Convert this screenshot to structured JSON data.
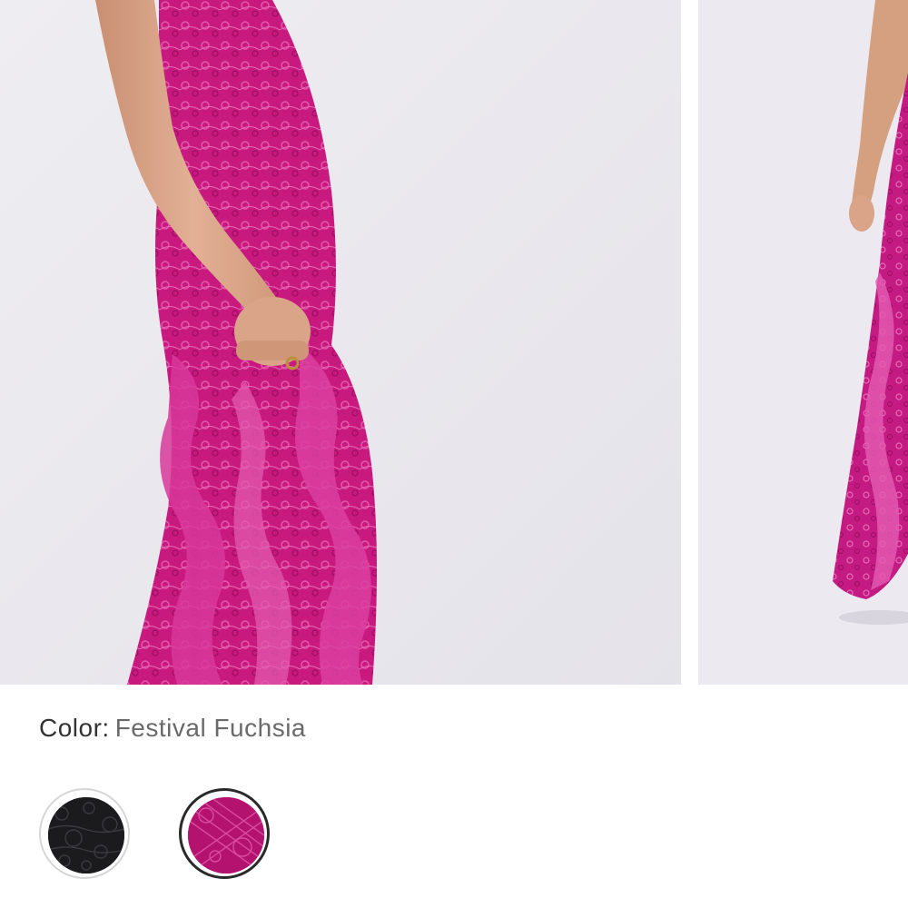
{
  "gallery": {
    "images": [
      {
        "name": "product-image-1",
        "alt": ""
      },
      {
        "name": "product-image-2",
        "alt": ""
      }
    ]
  },
  "color_selector": {
    "label": "Color:",
    "selected_value": "Festival Fuchsia",
    "swatches": [
      {
        "name": "black",
        "color": "#1b1b1d",
        "selected": false
      },
      {
        "name": "fuchsia",
        "color": "#b3126f",
        "selected": true
      }
    ]
  },
  "colors": {
    "background": "#ebe9ee",
    "dress": "#c8197f",
    "dress_light": "#e04ca6",
    "skin": "#d9a487"
  }
}
